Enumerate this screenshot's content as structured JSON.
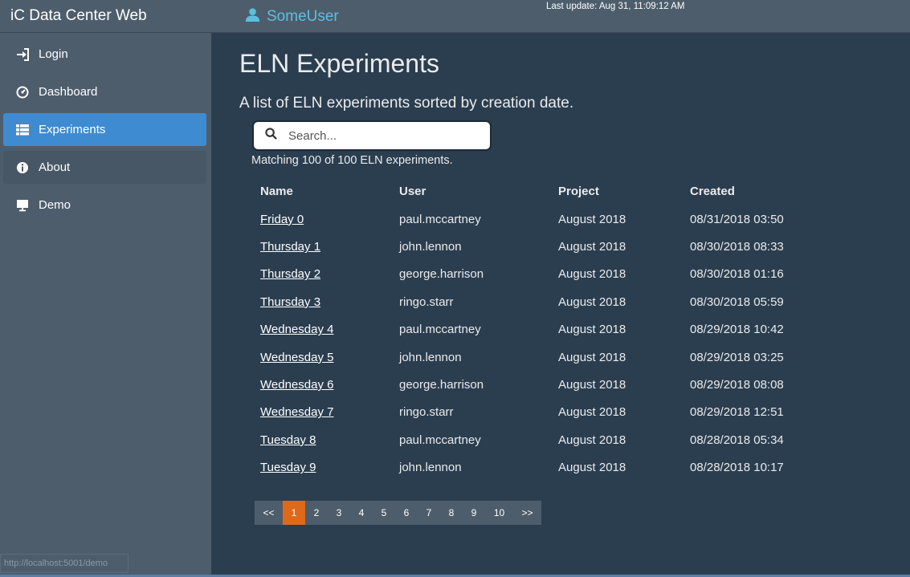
{
  "header": {
    "brand": "iC Data Center Web",
    "user": "SomeUser",
    "last_update": "Last update: Aug 31, 11:09:12 AM"
  },
  "sidebar": {
    "items": [
      {
        "label": "Login",
        "icon": "login-icon"
      },
      {
        "label": "Dashboard",
        "icon": "dashboard-icon"
      },
      {
        "label": "Experiments",
        "icon": "list-icon",
        "active": true
      },
      {
        "label": "About",
        "icon": "info-icon"
      },
      {
        "label": "Demo",
        "icon": "monitor-icon"
      }
    ]
  },
  "main": {
    "title": "ELN Experiments",
    "subtitle": "A list of ELN experiments sorted by creation date.",
    "search_placeholder": "Search...",
    "matching": "Matching 100 of 100 ELN experiments.",
    "columns": [
      "Name",
      "User",
      "Project",
      "Created"
    ],
    "rows": [
      {
        "name": "Friday 0",
        "user": "paul.mccartney",
        "project": "August 2018",
        "created": "08/31/2018 03:50"
      },
      {
        "name": "Thursday 1",
        "user": "john.lennon",
        "project": "August 2018",
        "created": "08/30/2018 08:33"
      },
      {
        "name": "Thursday 2",
        "user": "george.harrison",
        "project": "August 2018",
        "created": "08/30/2018 01:16"
      },
      {
        "name": "Thursday 3",
        "user": "ringo.starr",
        "project": "August 2018",
        "created": "08/30/2018 05:59"
      },
      {
        "name": "Wednesday 4",
        "user": "paul.mccartney",
        "project": "August 2018",
        "created": "08/29/2018 10:42"
      },
      {
        "name": "Wednesday 5",
        "user": "john.lennon",
        "project": "August 2018",
        "created": "08/29/2018 03:25"
      },
      {
        "name": "Wednesday 6",
        "user": "george.harrison",
        "project": "August 2018",
        "created": "08/29/2018 08:08"
      },
      {
        "name": "Wednesday 7",
        "user": "ringo.starr",
        "project": "August 2018",
        "created": "08/29/2018 12:51"
      },
      {
        "name": "Tuesday 8",
        "user": "paul.mccartney",
        "project": "August 2018",
        "created": "08/28/2018 05:34"
      },
      {
        "name": "Tuesday 9",
        "user": "john.lennon",
        "project": "August 2018",
        "created": "08/28/2018 10:17"
      }
    ],
    "pagination": {
      "prev": "<<",
      "pages": [
        "1",
        "2",
        "3",
        "4",
        "5",
        "6",
        "7",
        "8",
        "9",
        "10"
      ],
      "next": ">>",
      "current": "1"
    }
  },
  "status_url": "http://localhost:5001/demo",
  "colors": {
    "accent": "#3f8bd1",
    "active_page": "#df691a",
    "user_link": "#5bc0de",
    "background": "#2b3e50",
    "panel": "#4e5d6c"
  }
}
